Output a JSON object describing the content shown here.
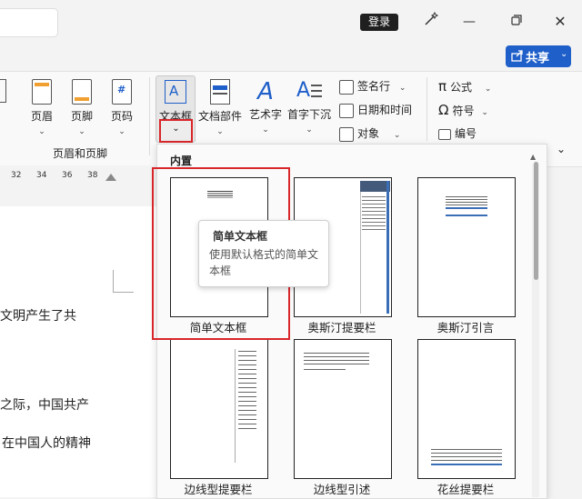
{
  "titlebar": {
    "login": "登录"
  },
  "share": {
    "label": "共享"
  },
  "ribbon": {
    "header_footer": {
      "header": "页眉",
      "footer": "页脚",
      "page_number": "页码",
      "group_label": "页眉和页脚"
    },
    "text": {
      "textbox": "文本框",
      "doc_parts": "文档部件",
      "wordart": "艺术字",
      "dropcap": "首字下沉",
      "signature_line": "签名行",
      "date_time": "日期和时间",
      "object": "对象"
    },
    "symbols": {
      "equation": "公式",
      "symbol": "符号",
      "number": "编号"
    }
  },
  "ruler": {
    "ticks": [
      "32",
      "34",
      "36",
      "38"
    ]
  },
  "document": {
    "lines": [
      "文明产生了共",
      "之际，中国共产",
      "在中国人的精神"
    ]
  },
  "gallery": {
    "section_title": "内置",
    "items": [
      {
        "label": "简单文本框"
      },
      {
        "label": "奥斯汀提要栏"
      },
      {
        "label": "奥斯汀引言"
      },
      {
        "label": "边线型提要栏"
      },
      {
        "label": "边线型引述"
      },
      {
        "label": "花丝提要栏"
      }
    ]
  },
  "tooltip": {
    "title": "简单文本框",
    "description": "使用默认格式的简单文本框"
  },
  "colors": {
    "accent": "#1f5fc9",
    "highlight": "#d9262a"
  }
}
